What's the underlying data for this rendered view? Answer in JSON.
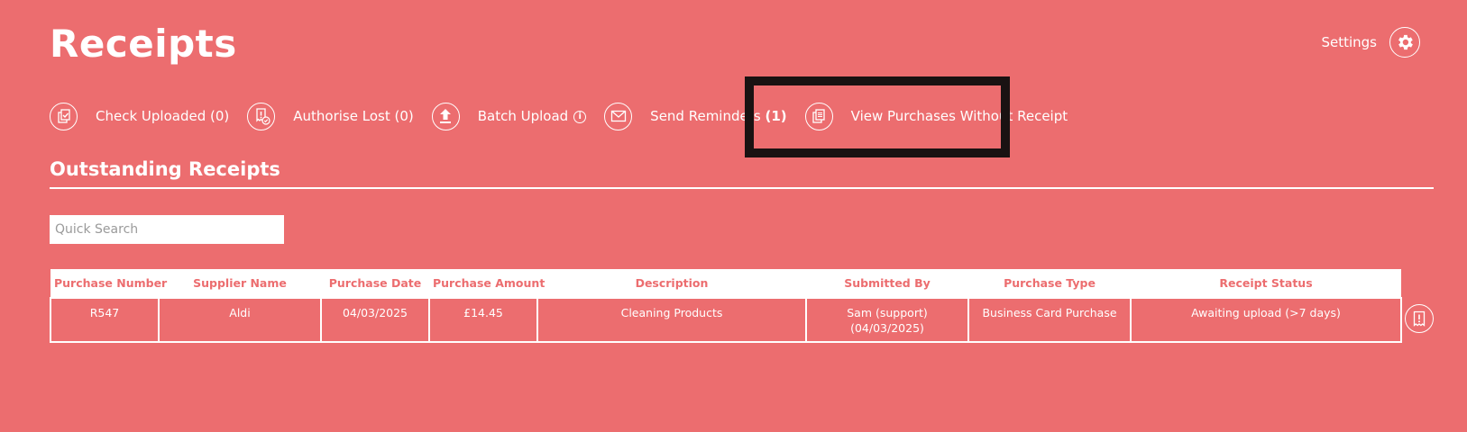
{
  "page": {
    "title": "Receipts"
  },
  "settings": {
    "label": "Settings",
    "icon": "gear-icon"
  },
  "toolbar": {
    "check_uploaded": {
      "label": "Check Uploaded (0)",
      "icon": "check-document-icon"
    },
    "authorise_lost": {
      "label": "Authorise Lost (0)",
      "icon": "lost-receipt-icon"
    },
    "batch_upload": {
      "label": "Batch Upload",
      "icon": "upload-arrow-icon",
      "info_icon": "info-icon"
    },
    "send_reminders": {
      "label": "Send Reminders",
      "count": "(1)",
      "icon": "envelope-icon"
    },
    "view_without_receipt": {
      "label": "View Purchases Without Receipt",
      "icon": "documents-icon"
    }
  },
  "section": {
    "title": "Outstanding Receipts"
  },
  "search": {
    "placeholder": "Quick Search",
    "value": ""
  },
  "table": {
    "columns": [
      "Purchase Number",
      "Supplier Name",
      "Purchase Date",
      "Purchase Amount",
      "Description",
      "Submitted By",
      "Purchase Type",
      "Receipt Status"
    ],
    "rows": [
      {
        "purchase_number": "R547",
        "supplier_name": "Aldi",
        "purchase_date": "04/03/2025",
        "purchase_amount": "£14.45",
        "description": "Cleaning Products",
        "submitted_by": "Sam (support)",
        "submitted_date": "(04/03/2025)",
        "purchase_type": "Business Card Purchase",
        "receipt_status": "Awaiting upload (>7 days)"
      }
    ],
    "row_action_icon": "receipt-alert-icon"
  },
  "colors": {
    "background": "#ec6d6f",
    "foreground": "#ffffff",
    "highlight": "#1a1212"
  }
}
